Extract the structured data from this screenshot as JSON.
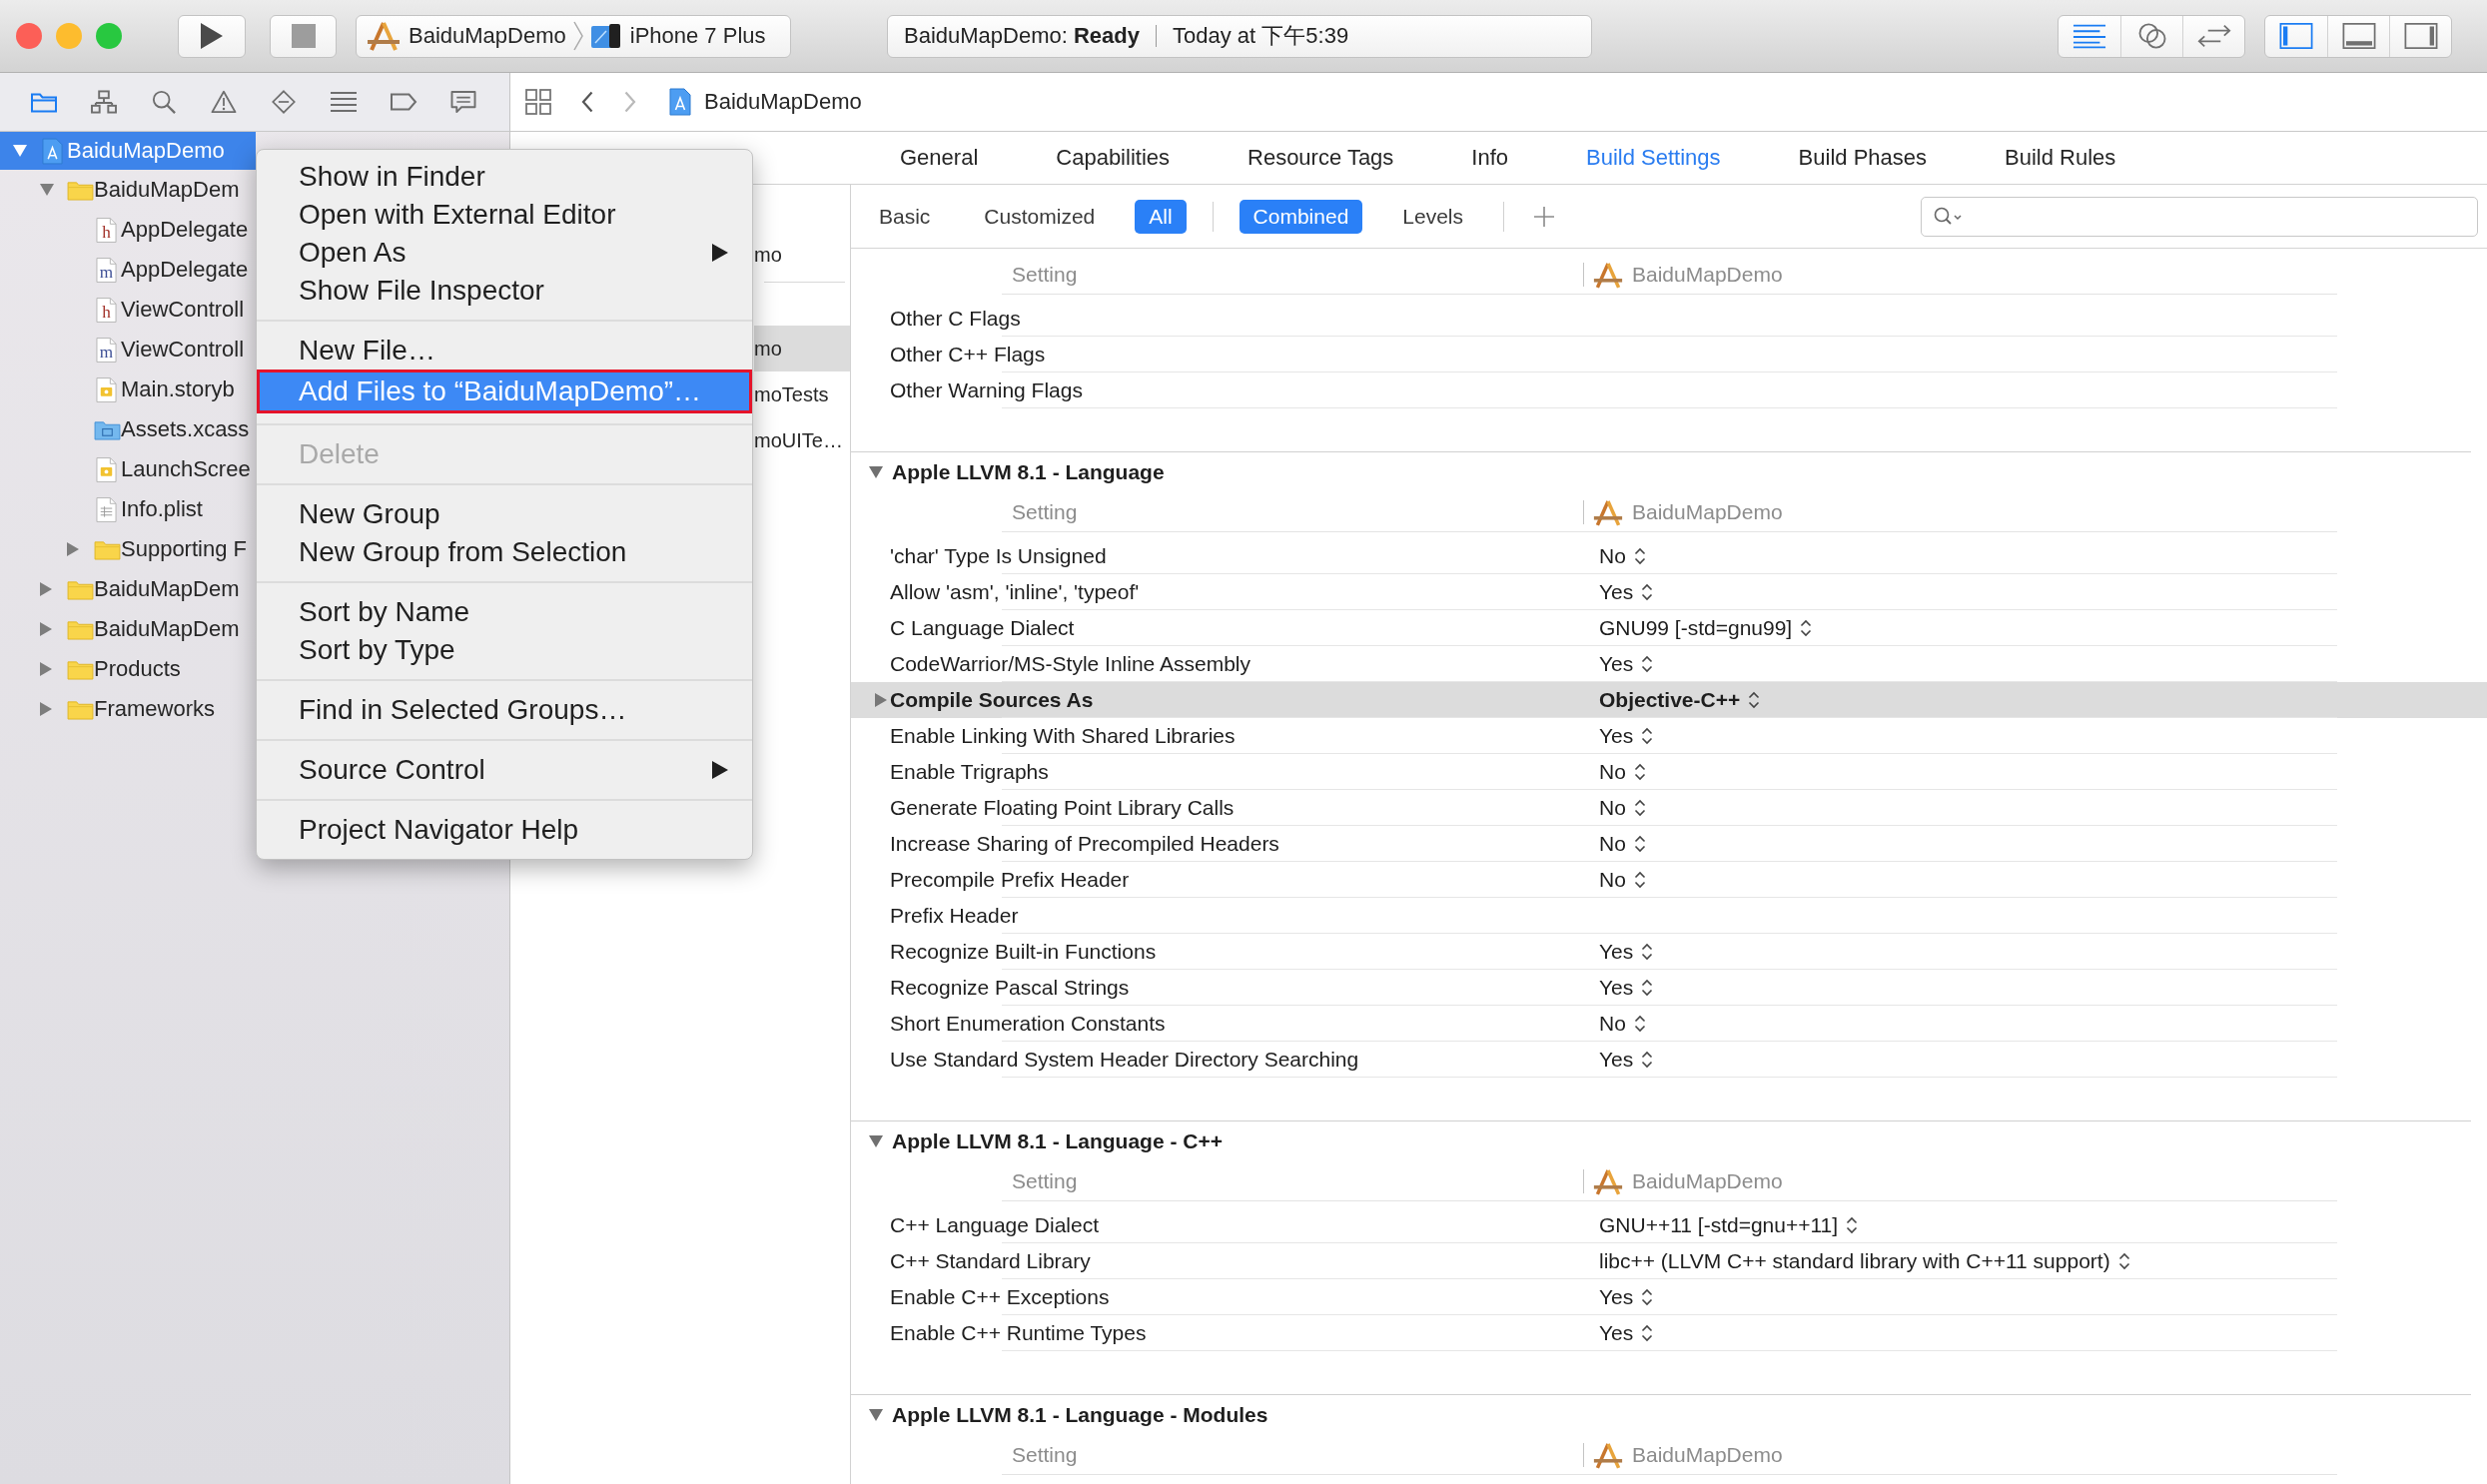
{
  "toolbar": {
    "window_controls": [
      {
        "color": "#fc5f57"
      },
      {
        "color": "#fdbc2e"
      },
      {
        "color": "#28c840"
      }
    ],
    "scheme": "BaiduMapDemo",
    "destination": "iPhone 7 Plus",
    "status": "BaiduMapDemo: **Ready**",
    "timestamp": "Today at 下午5:39",
    "editor_modes": [
      {
        "kind": "standard",
        "selected": true
      },
      {
        "kind": "assistant",
        "selected": false
      },
      {
        "kind": "version",
        "selected": false
      }
    ],
    "panels": [
      {
        "kind": "navigator",
        "on": true
      },
      {
        "kind": "debug",
        "on": false
      },
      {
        "kind": "utilities",
        "on": false
      }
    ]
  },
  "navigator": {
    "tabs": [
      {
        "kind": "project",
        "selected": true
      },
      {
        "kind": "symbol",
        "selected": false
      },
      {
        "kind": "find",
        "selected": false
      },
      {
        "kind": "issue",
        "selected": false
      },
      {
        "kind": "test",
        "selected": false
      },
      {
        "kind": "debug",
        "selected": false
      },
      {
        "kind": "breakpoint",
        "selected": false
      },
      {
        "kind": "report",
        "selected": false
      }
    ],
    "tree": [
      {
        "name": "BaiduMapDemo",
        "kind": "project",
        "expanded": true,
        "selected": true,
        "children": [
          {
            "name": "BaiduMapDem",
            "kind": "folder",
            "expanded": true,
            "selected": false,
            "children": [
              {
                "name": "AppDelegate",
                "kind": "header",
                "badge": "h",
                "selected": false
              },
              {
                "name": "AppDelegate",
                "kind": "source",
                "badge": "m",
                "selected": false
              },
              {
                "name": "ViewControll",
                "kind": "header",
                "badge": "h",
                "selected": false
              },
              {
                "name": "ViewControll",
                "kind": "source",
                "badge": "m",
                "selected": false
              },
              {
                "name": "Main.storyb",
                "kind": "storyboard",
                "selected": false
              },
              {
                "name": "Assets.xcass",
                "kind": "assets",
                "selected": false
              },
              {
                "name": "LaunchScree",
                "kind": "storyboard",
                "selected": false
              },
              {
                "name": "Info.plist",
                "kind": "plist",
                "selected": false
              },
              {
                "name": "Supporting F",
                "kind": "folder",
                "expanded": false,
                "selected": false
              }
            ]
          },
          {
            "name": "BaiduMapDem",
            "kind": "folder",
            "expanded": false,
            "selected": false
          },
          {
            "name": "BaiduMapDem",
            "kind": "folder",
            "expanded": false,
            "selected": false
          },
          {
            "name": "Products",
            "kind": "folder",
            "expanded": false,
            "selected": false
          },
          {
            "name": "Frameworks",
            "kind": "folder",
            "expanded": false,
            "selected": false
          }
        ]
      }
    ]
  },
  "jump_bar": {
    "history": [
      {
        "kind": "back",
        "disabled": false
      },
      {
        "kind": "forward",
        "disabled": true
      }
    ],
    "path_item": "BaiduMapDemo"
  },
  "project_list": {
    "project_items": [
      {
        "label": "mo",
        "selected": false
      }
    ],
    "target_items": [
      {
        "label": "mo",
        "selected": true
      },
      {
        "label": "moTests",
        "selected": false
      },
      {
        "label": "moUITe…",
        "selected": false
      }
    ]
  },
  "editor": {
    "tabs": [
      {
        "label": "General",
        "selected": false
      },
      {
        "label": "Capabilities",
        "selected": false
      },
      {
        "label": "Resource Tags",
        "selected": false
      },
      {
        "label": "Info",
        "selected": false
      },
      {
        "label": "Build Settings",
        "selected": true
      },
      {
        "label": "Build Phases",
        "selected": false
      },
      {
        "label": "Build Rules",
        "selected": false
      }
    ],
    "scope_filters": [
      {
        "label": "Basic",
        "selected": false
      },
      {
        "label": "Customized",
        "selected": false
      },
      {
        "label": "All",
        "selected": true
      }
    ],
    "view_filters": [
      {
        "label": "Combined",
        "selected": true
      },
      {
        "label": "Levels",
        "selected": false
      }
    ]
  },
  "settings": {
    "sections": [
      {
        "header": "Setting",
        "target": "BaiduMapDemo",
        "rows": [
          {
            "name": "Other C Flags",
            "customized": false,
            "selected": false
          },
          {
            "name": "Other C++ Flags",
            "customized": false,
            "selected": false
          },
          {
            "name": "Other Warning Flags",
            "customized": false,
            "selected": false
          }
        ]
      },
      {
        "title": "Apple LLVM 8.1 - Language",
        "expanded": true,
        "header": "Setting",
        "target": "BaiduMapDemo",
        "rows": [
          {
            "name": "'char' Type Is Unsigned",
            "value": "No",
            "customized": false,
            "selected": false
          },
          {
            "name": "Allow 'asm', 'inline', 'typeof'",
            "value": "Yes",
            "customized": false,
            "selected": false
          },
          {
            "name": "C Language Dialect",
            "value": "GNU99 [-std=gnu99]",
            "customized": false,
            "selected": false
          },
          {
            "name": "CodeWarrior/MS-Style Inline Assembly",
            "value": "Yes",
            "customized": false,
            "selected": false
          },
          {
            "name": "Compile Sources As",
            "value": "Objective-C++",
            "customized": true,
            "selected": true
          },
          {
            "name": "Enable Linking With Shared Libraries",
            "value": "Yes",
            "customized": false,
            "selected": false
          },
          {
            "name": "Enable Trigraphs",
            "value": "No",
            "customized": false,
            "selected": false
          },
          {
            "name": "Generate Floating Point Library Calls",
            "value": "No",
            "customized": false,
            "selected": false
          },
          {
            "name": "Increase Sharing of Precompiled Headers",
            "value": "No",
            "customized": false,
            "selected": false
          },
          {
            "name": "Precompile Prefix Header",
            "value": "No",
            "customized": false,
            "selected": false
          },
          {
            "name": "Prefix Header",
            "customized": false,
            "selected": false
          },
          {
            "name": "Recognize Built-in Functions",
            "value": "Yes",
            "customized": false,
            "selected": false
          },
          {
            "name": "Recognize Pascal Strings",
            "value": "Yes",
            "customized": false,
            "selected": false
          },
          {
            "name": "Short Enumeration Constants",
            "value": "No",
            "customized": false,
            "selected": false
          },
          {
            "name": "Use Standard System Header Directory Searching",
            "value": "Yes",
            "customized": false,
            "selected": false
          }
        ]
      },
      {
        "title": "Apple LLVM 8.1 - Language - C++",
        "expanded": true,
        "header": "Setting",
        "target": "BaiduMapDemo",
        "rows": [
          {
            "name": "C++ Language Dialect",
            "value": "GNU++11 [-std=gnu++11]",
            "customized": false,
            "selected": false
          },
          {
            "name": "C++ Standard Library",
            "value": "libc++ (LLVM C++ standard library with C++11 support)",
            "customized": false,
            "selected": false
          },
          {
            "name": "Enable C++ Exceptions",
            "value": "Yes",
            "customized": false,
            "selected": false
          },
          {
            "name": "Enable C++ Runtime Types",
            "value": "Yes",
            "customized": false,
            "selected": false
          }
        ]
      },
      {
        "title": "Apple LLVM 8.1 - Language - Modules",
        "expanded": true,
        "header": "Setting",
        "target": "BaiduMapDemo"
      }
    ]
  },
  "context_menu": {
    "groups": [
      {
        "items": [
          {
            "label": "Show in Finder",
            "selected": false,
            "disabled": false,
            "submenu": false,
            "outlined": false
          },
          {
            "label": "Open with External Editor",
            "selected": false,
            "disabled": false,
            "submenu": false,
            "outlined": false
          },
          {
            "label": "Open As",
            "selected": false,
            "disabled": false,
            "submenu": true,
            "outlined": false
          },
          {
            "label": "Show File Inspector",
            "selected": false,
            "disabled": false,
            "submenu": false,
            "outlined": false
          }
        ]
      },
      {
        "items": [
          {
            "label": "New File…",
            "selected": false,
            "disabled": false,
            "submenu": false,
            "outlined": false
          },
          {
            "label": "Add Files to “BaiduMapDemo”…",
            "selected": true,
            "disabled": false,
            "submenu": false,
            "outlined": true
          }
        ]
      },
      {
        "items": [
          {
            "label": "Delete",
            "selected": false,
            "disabled": true,
            "submenu": false,
            "outlined": false
          }
        ]
      },
      {
        "items": [
          {
            "label": "New Group",
            "selected": false,
            "disabled": false,
            "submenu": false,
            "outlined": false
          },
          {
            "label": "New Group from Selection",
            "selected": false,
            "disabled": false,
            "submenu": false,
            "outlined": false
          }
        ]
      },
      {
        "items": [
          {
            "label": "Sort by Name",
            "selected": false,
            "disabled": false,
            "submenu": false,
            "outlined": false
          },
          {
            "label": "Sort by Type",
            "selected": false,
            "disabled": false,
            "submenu": false,
            "outlined": false
          }
        ]
      },
      {
        "items": [
          {
            "label": "Find in Selected Groups…",
            "selected": false,
            "disabled": false,
            "submenu": false,
            "outlined": false
          }
        ]
      },
      {
        "items": [
          {
            "label": "Source Control",
            "selected": false,
            "disabled": false,
            "submenu": true,
            "outlined": false
          }
        ]
      },
      {
        "items": [
          {
            "label": "Project Navigator Help",
            "selected": false,
            "disabled": false,
            "submenu": false,
            "outlined": false
          }
        ]
      }
    ]
  }
}
